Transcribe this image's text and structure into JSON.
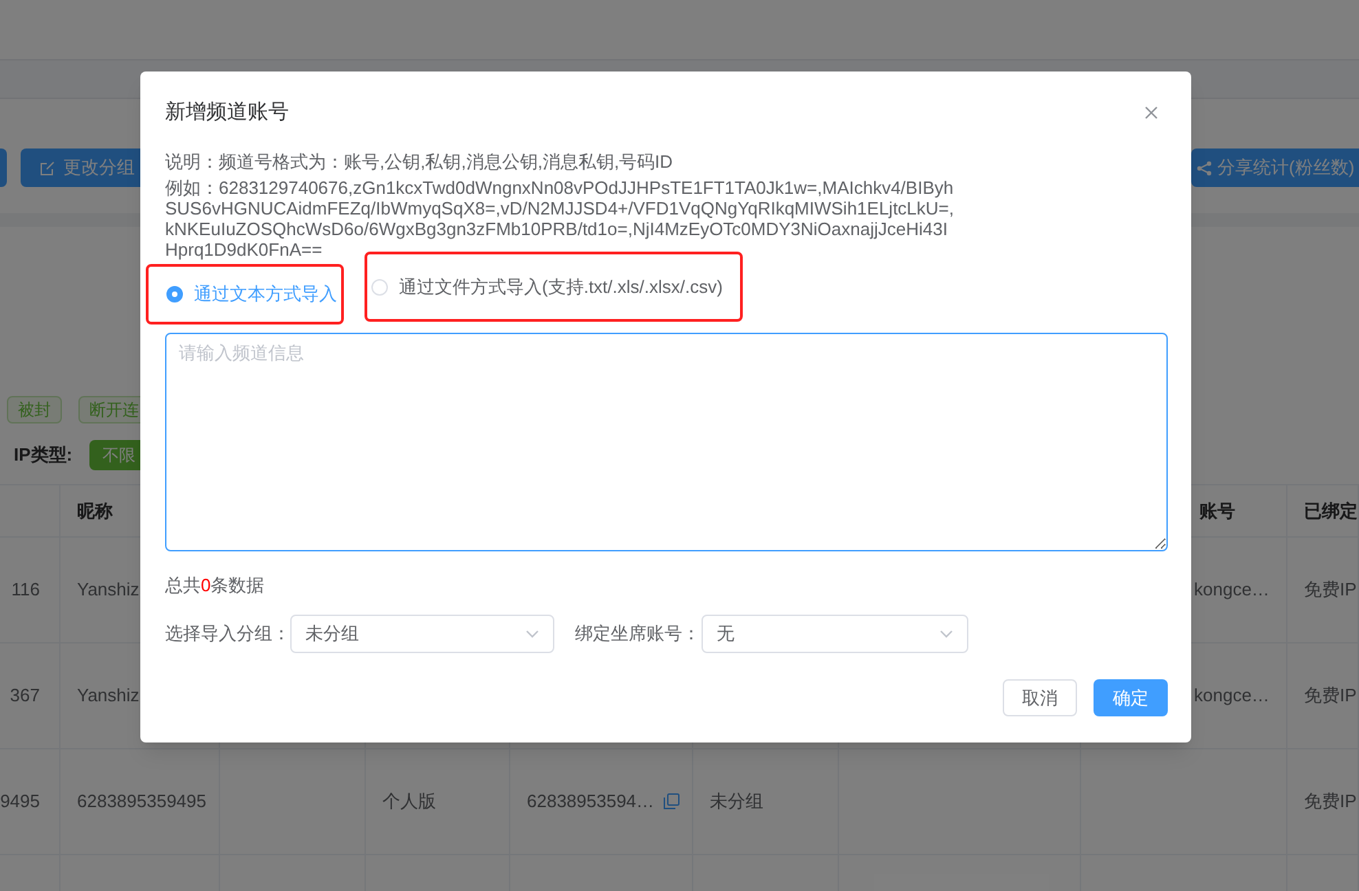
{
  "toolbar": {
    "edit_group_button": "更改分组",
    "share_stats_button": "分享统计(粉丝数)"
  },
  "status_tags": [
    "被封",
    "断开连"
  ],
  "ip_filter": {
    "label": "IP类型:",
    "option": "不限"
  },
  "table": {
    "header": {
      "column_2": "昵称",
      "column_8": "账号",
      "column_9": "已绑定"
    },
    "rows": [
      {
        "column_1": "116",
        "column_2": "Yanshiz",
        "column_8": "kongce…",
        "column_9": "免费IP"
      },
      {
        "column_1": "367",
        "column_2": "Yanshiz",
        "column_8": "kongce…",
        "column_9": "免费IP"
      },
      {
        "column_1": "9495",
        "column_2": "6283895359495",
        "column_4": "个人版",
        "column_5": "62838953594…",
        "column_6": "未分组",
        "column_9": "免费IP"
      }
    ]
  },
  "dialog": {
    "title": "新增频道账号",
    "description": "说明：频道号格式为：账号,公钥,私钥,消息公钥,消息私钥,号码ID",
    "example_lines": [
      "例如：6283129740676,zGn1kcxTwd0dWngnxNn08vPOdJJHPsTE1FT1TA0Jk1w=,MAIchkv4/BIByh",
      "SUS6vHGNUCAidmFEZq/IbWmyqSqX8=,vD/N2MJJSD4+/VFD1VqQNgYqRIkqMIWSih1ELjtcLkU=,",
      "kNKEuIuZOSQhcWsD6o/6WgxBg3gn3zFMb10PRB/td1o=,NjI4MzEyOTc0MDY3NiOaxnajjJceHi43I",
      "Hprq1D9dK0FnA=="
    ],
    "import_modes": [
      {
        "label": "通过文本方式导入",
        "selected": true
      },
      {
        "label": "通过文件方式导入(支持.txt/.xls/.xlsx/.csv)",
        "selected": false
      }
    ],
    "input": {
      "placeholder": "请输入频道信息"
    },
    "count": {
      "prefix": "总共",
      "value": "0",
      "suffix": "条数据"
    },
    "group_select": {
      "label": "选择导入分组：",
      "value": "未分组"
    },
    "seat_select": {
      "label": "绑定坐席账号：",
      "value": "无"
    },
    "buttons": {
      "cancel": "取消",
      "confirm": "确定"
    }
  }
}
